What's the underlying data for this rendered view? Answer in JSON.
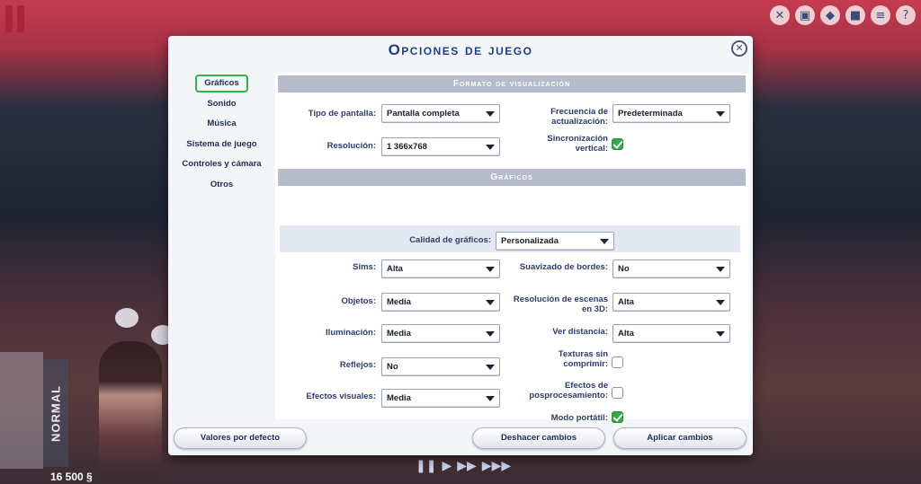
{
  "hud": {
    "money": "16 500 §",
    "speed_label": "NORMAL",
    "pause_icon": "pause-icon",
    "top_icons": [
      "tools-icon",
      "photo-icon",
      "diamond-icon",
      "cube-icon",
      "menu-icon",
      "help-icon"
    ],
    "bottom_controls": [
      "pause-icon",
      "play-icon",
      "fast-forward-icon",
      "ultra-speed-icon"
    ]
  },
  "dialog": {
    "title": "Opciones de juego",
    "close_icon": "close-icon",
    "nav": [
      {
        "label": "Gráficos",
        "active": true
      },
      {
        "label": "Sonido",
        "active": false
      },
      {
        "label": "Música",
        "active": false
      },
      {
        "label": "Sistema de juego",
        "active": false
      },
      {
        "label": "Controles y cámara",
        "active": false
      },
      {
        "label": "Otros",
        "active": false
      }
    ],
    "display_section": {
      "header": "Formato de visualización",
      "screen_type_label": "Tipo de pantalla:",
      "screen_type_value": "Pantalla completa",
      "resolution_label": "Resolución:",
      "resolution_value": "1 366x768",
      "refresh_label_1": "Frecuencia de",
      "refresh_label_2": "actualización:",
      "refresh_value": "Predeterminada",
      "vsync_label_1": "Sincronización",
      "vsync_label_2": "vertical:",
      "vsync_checked": true
    },
    "graphics_section": {
      "header": "Gráficos",
      "quality_label": "Calidad de gráficos:",
      "quality_value": "Personalizada",
      "sims_label": "Sims:",
      "sims_value": "Alta",
      "objects_label": "Objetos:",
      "objects_value": "Media",
      "lighting_label": "Iluminación:",
      "lighting_value": "Media",
      "reflections_label": "Reflejos:",
      "reflections_value": "No",
      "visual_effects_label": "Efectos visuales:",
      "visual_effects_value": "Media",
      "edge_smoothing_label": "Suavizado de bordes:",
      "edge_smoothing_value": "No",
      "scene_res_label_1": "Resolución de escenas",
      "scene_res_label_2": "en 3D:",
      "scene_res_value": "Alta",
      "view_distance_label": "Ver distancia:",
      "view_distance_value": "Alta",
      "uncompressed_label_1": "Texturas sin",
      "uncompressed_label_2": "comprimir:",
      "uncompressed_checked": false,
      "postprocess_label_1": "Efectos de",
      "postprocess_label_2": "posprocesamiento:",
      "postprocess_checked": false,
      "laptop_label": "Modo portátil:",
      "laptop_checked": true
    },
    "footer": {
      "defaults_button": "Valores por defecto",
      "undo_button": "Deshacer cambios",
      "apply_button": "Aplicar cambios"
    }
  }
}
